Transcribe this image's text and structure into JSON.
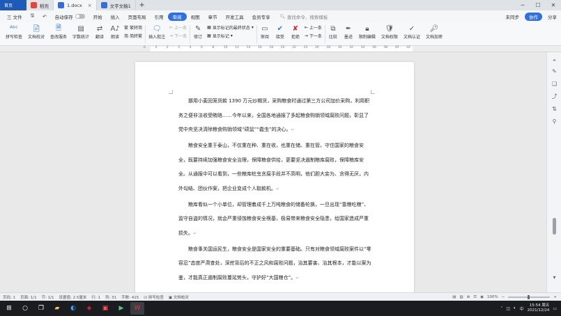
{
  "tabs": {
    "home": "首页",
    "items": [
      {
        "label": "稻壳",
        "color": "#e0473a"
      },
      {
        "label": "1.docx",
        "color": "#2f6fe0"
      },
      {
        "label": "文字文稿1",
        "color": "#2f6fe0"
      }
    ],
    "new": "+"
  },
  "menu": {
    "file": "三 文件",
    "autosave": "自动保存",
    "items": [
      "开始",
      "插入",
      "页面布局",
      "引用",
      "审阅",
      "视图",
      "章节",
      "开发工具",
      "会员专享"
    ],
    "active": "审阅",
    "search_placeholder": "查找命令、搜索模板",
    "unsynced": "未同步",
    "collab": "协作",
    "share": "分享"
  },
  "ribbon": {
    "spell": "拼写检查",
    "proof": "文档校对",
    "compare_svc": "查改服务",
    "count": "字数统计",
    "translate": "翻译",
    "read": "朗读",
    "simp": "繁转简",
    "trad": "简转繁",
    "insert_comment": "插入批注",
    "prev_comment": "上一条",
    "next_comment": "下一条",
    "revise": "修订",
    "final_state": "显示标记的最终状态",
    "show_marks": "显示标记",
    "review": "审阅",
    "accept": "接受",
    "reject": "拒绝",
    "prev": "上一条",
    "next": "下一条",
    "compare": "比较",
    "ink": "墨迹",
    "limit_edit": "限制编辑",
    "doc_rights": "文档权限",
    "doc_cert": "文档认证",
    "doc_encrypt": "文档加密"
  },
  "ruler": [
    "6",
    "4",
    "2",
    "2",
    "4",
    "6",
    "8",
    "10",
    "12",
    "14",
    "16",
    "18",
    "20",
    "22",
    "24",
    "26",
    "28",
    "30",
    "32",
    "34",
    "36",
    "38",
    "40",
    "42"
  ],
  "document": {
    "paragraphs": [
      "挪用小麦回笼货款 1390 万元炒期货，采购粮食时通过第三方公司加价采购，利用职务之便非法收受贿赂……今年以来，全国各地通报了多起粮食购销领域腐败问题，彰显了党中央坚决清除粮食购销领域“硕鼠”“蠹虫”的决心。",
      "粮食安全重于泰山，不仅重在种、重在收，也重在储、重在管。守住国家的粮食安全，既要持续加强粮食安全治理，保障粮食供给，更要坚决遏制粮库腐败，保障粮库安全。从通报中可以看到，一些粮库蛀虫贪腐手段并不高明，他们胆大妄为、贪得无厌，内外勾结、团伙作案，把企业变成个人取款机。",
      "粮库看似一个小单位，却管理着成千上万吨粮食的储备轮换，一旦出现“靠粮吃粮”、监守自盗的情况，就会严重侵蚀粮食安全根基，极易带来粮食安全隐患，给国家造成严重损失。",
      "粮食事关国运民生，粮食安全是国家安全的重要基础。只有对粮食领域腐败案件以“零容忍”态度严肃查处，深挖背后的不正之风和腐败问题，治其要害、治其根本，才能以案为鉴，才能真正遏制腐败蔓延势头，守护好“大国粮仓”。"
    ],
    "para_mark": "↵"
  },
  "status": {
    "page_no": "页码: 1",
    "pages": "页面: 1/1",
    "section": "节: 1/1",
    "position": "设置值: 2.5厘米",
    "row": "行: 1",
    "col": "列: 31",
    "words": "字数: 415",
    "spell": "拼写检查",
    "proof": "文档校对",
    "zoom": "100%"
  },
  "taskbar": {
    "time": "15:54 周五",
    "date": "2021/12/24"
  }
}
